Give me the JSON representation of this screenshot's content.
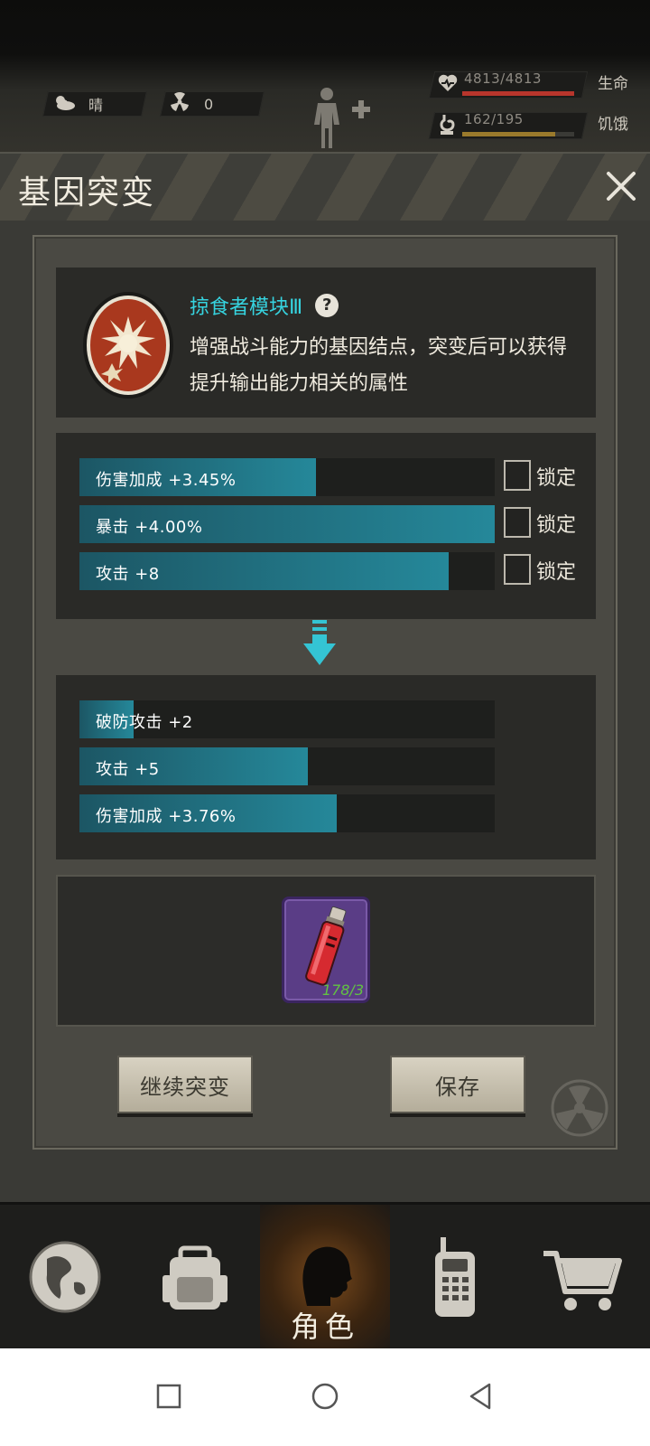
{
  "hud": {
    "weather": {
      "icon": "cloud-sun-icon",
      "label": "晴"
    },
    "radiation": {
      "icon": "radiation-icon",
      "value": "0"
    },
    "health": {
      "icon": "heart-icon",
      "value": "4813/4813",
      "label": "生命",
      "fraction": 1.0,
      "color": "#b8352c"
    },
    "hunger": {
      "icon": "stomach-icon",
      "value": "162/195",
      "label": "饥饿",
      "fraction": 0.83,
      "color": "#9a7a2c"
    }
  },
  "modal": {
    "title": "基因突变",
    "module": {
      "name": "掠食者模块Ⅲ",
      "help": "?",
      "desc_line1": "增强战斗能力的基因结点，突变后可以获得",
      "desc_line2": "提升输出能力相关的属性"
    },
    "current_attrs": [
      {
        "text": "伤害加成 +3.45%",
        "fill": 0.57,
        "lock_label": "锁定"
      },
      {
        "text": "暴击 +4.00%",
        "fill": 1.0,
        "lock_label": "锁定"
      },
      {
        "text": "攻击 +8",
        "fill": 0.89,
        "lock_label": "锁定"
      }
    ],
    "new_attrs": [
      {
        "text": "破防攻击 +2",
        "fill": 0.13
      },
      {
        "text": "攻击 +5",
        "fill": 0.55
      },
      {
        "text": "伤害加成 +3.76%",
        "fill": 0.62
      }
    ],
    "item": {
      "icon": "vial-icon",
      "count": "178/3"
    },
    "buttons": {
      "continue": "继续突变",
      "save": "保存"
    }
  },
  "tabbar": {
    "world": {
      "icon": "globe-icon"
    },
    "bag": {
      "icon": "backpack-icon"
    },
    "role": {
      "icon": "head-profile-icon",
      "label": "角色"
    },
    "radio": {
      "icon": "walkie-talkie-icon"
    },
    "shop": {
      "icon": "cart-icon"
    }
  },
  "colors": {
    "accent": "#36d4e0",
    "bar_fill": "#25889a",
    "bar_bg": "#1e1f1d",
    "panel": "#4a4943"
  }
}
